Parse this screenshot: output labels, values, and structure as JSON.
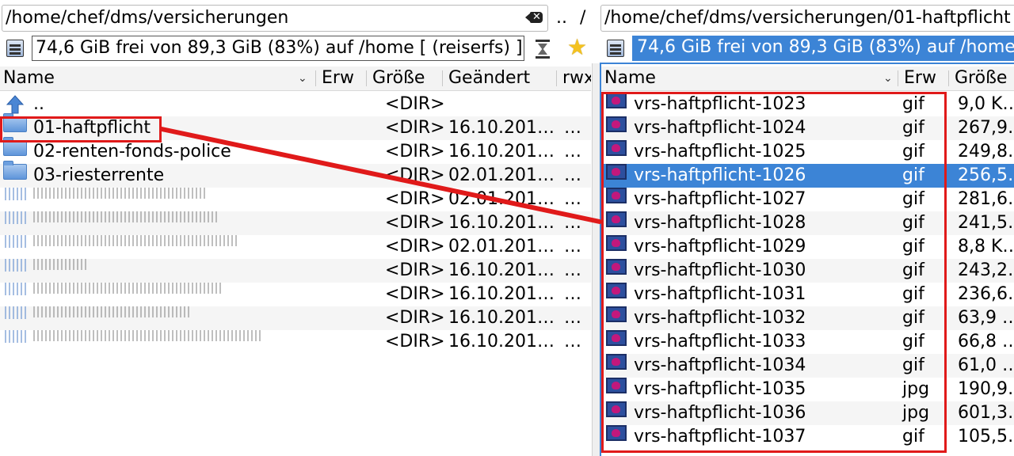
{
  "left_panel": {
    "path": "/home/chef/dms/versicherungen",
    "free_space": "74,6 GiB frei von 89,3 GiB (83%) auf /home [ (reiserfs) ]",
    "columns": {
      "name": "Name",
      "ext": "Erw",
      "size": "Größe",
      "modified": "Geändert",
      "perms": "rwx"
    },
    "rows": [
      {
        "name": "..",
        "size": "<DIR>",
        "modified": "",
        "perms": "",
        "type": "up"
      },
      {
        "name": "01-haftpflicht",
        "size": "<DIR>",
        "modified": "16.10.201…",
        "perms": "…",
        "type": "folder"
      },
      {
        "name": "02-renten-fonds-police",
        "size": "<DIR>",
        "modified": "16.10.201…",
        "perms": "…",
        "type": "folder"
      },
      {
        "name": "03-riesterrente",
        "size": "<DIR>",
        "modified": "02.01.201…",
        "perms": "…",
        "type": "folder"
      },
      {
        "name": "",
        "size": "<DIR>",
        "modified": "02.01.201…",
        "perms": "…",
        "type": "blurred",
        "blur_w": 220
      },
      {
        "name": "",
        "size": "<DIR>",
        "modified": "16.10.201…",
        "perms": "…",
        "type": "blurred",
        "blur_w": 235
      },
      {
        "name": "",
        "size": "<DIR>",
        "modified": "02.01.201…",
        "perms": "…",
        "type": "blurred",
        "blur_w": 260
      },
      {
        "name": "",
        "size": "<DIR>",
        "modified": "16.10.201…",
        "perms": "…",
        "type": "blurred",
        "blur_w": 70
      },
      {
        "name": "",
        "size": "<DIR>",
        "modified": "16.10.201…",
        "perms": "…",
        "type": "blurred",
        "blur_w": 240
      },
      {
        "name": "",
        "size": "<DIR>",
        "modified": "16.10.201…",
        "perms": "…",
        "type": "blurred",
        "blur_w": 200
      },
      {
        "name": "",
        "size": "<DIR>",
        "modified": "16.10.201…",
        "perms": "…",
        "type": "blurred",
        "blur_w": 290
      }
    ]
  },
  "nav": {
    "parent": "..",
    "root": "/"
  },
  "right_panel": {
    "path": "/home/chef/dms/versicherungen/01-haftpflicht",
    "free_space": "74,6 GiB frei von 89,3 GiB (83%) auf /home",
    "columns": {
      "name": "Name",
      "ext": "Erw",
      "size": "Größe"
    },
    "rows": [
      {
        "name": "vrs-haftpflicht-1023",
        "ext": "gif",
        "size": "9,0 K…"
      },
      {
        "name": "vrs-haftpflicht-1024",
        "ext": "gif",
        "size": "267,9…"
      },
      {
        "name": "vrs-haftpflicht-1025",
        "ext": "gif",
        "size": "249,8…"
      },
      {
        "name": "vrs-haftpflicht-1026",
        "ext": "gif",
        "size": "256,5…",
        "selected": true
      },
      {
        "name": "vrs-haftpflicht-1027",
        "ext": "gif",
        "size": "281,6…"
      },
      {
        "name": "vrs-haftpflicht-1028",
        "ext": "gif",
        "size": "241,5…"
      },
      {
        "name": "vrs-haftpflicht-1029",
        "ext": "gif",
        "size": "8,8 K…"
      },
      {
        "name": "vrs-haftpflicht-1030",
        "ext": "gif",
        "size": "243,2…"
      },
      {
        "name": "vrs-haftpflicht-1031",
        "ext": "gif",
        "size": "236,6…"
      },
      {
        "name": "vrs-haftpflicht-1032",
        "ext": "gif",
        "size": "63,9 …"
      },
      {
        "name": "vrs-haftpflicht-1033",
        "ext": "gif",
        "size": "66,8 …"
      },
      {
        "name": "vrs-haftpflicht-1034",
        "ext": "gif",
        "size": "61,0 …"
      },
      {
        "name": "vrs-haftpflicht-1035",
        "ext": "jpg",
        "size": "190,9…"
      },
      {
        "name": "vrs-haftpflicht-1036",
        "ext": "jpg",
        "size": "601,3…"
      },
      {
        "name": "vrs-haftpflicht-1037",
        "ext": "gif",
        "size": "105,5…"
      }
    ]
  },
  "colors": {
    "selection": "#3c84d6",
    "annotation": "#e01a1a"
  }
}
